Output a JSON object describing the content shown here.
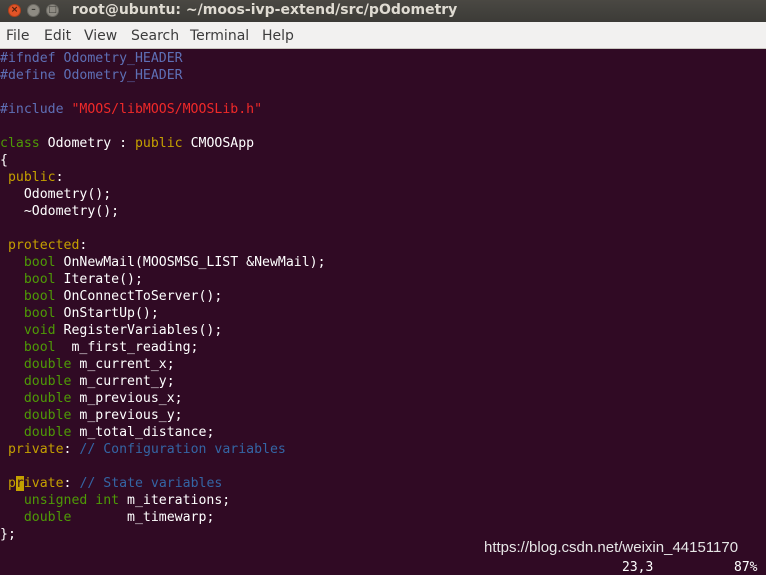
{
  "window": {
    "title": "root@ubuntu: ~/moos-ivp-extend/src/pOdometry",
    "close_glyph": "×",
    "minimize_glyph": "–",
    "maximize_glyph": "□"
  },
  "menu": [
    "File",
    "Edit",
    "View",
    "Search",
    "Terminal",
    "Help"
  ],
  "code": {
    "l1": "#ifndef Odometry_HEADER",
    "l2": "#define Odometry_HEADER",
    "l4": "#include ",
    "l4s": "\"MOOS/libMOOS/MOOSLib.h\"",
    "l6a": "class",
    "l6b": " Odometry : ",
    "l6c": "public",
    "l6d": " CMOOSApp",
    "l7": "{",
    "l8a": " public",
    "l8b": ":",
    "l9": "   Odometry();",
    "l10": "   ~Odometry();",
    "l12a": " protected",
    "l12b": ":",
    "l13a": "   bool",
    "l13b": " OnNewMail(MOOSMSG_LIST &NewMail);",
    "l14a": "   bool",
    "l14b": " Iterate();",
    "l15a": "   bool",
    "l15b": " OnConnectToServer();",
    "l16a": "   bool",
    "l16b": " OnStartUp();",
    "l17a": "   void",
    "l17b": " RegisterVariables();",
    "l18a": "   bool",
    "l18b": "  m_first_reading;",
    "l19a": "   double",
    "l19b": " m_current_x;",
    "l20a": "   double",
    "l20b": " m_current_y;",
    "l21a": "   double",
    "l21b": " m_previous_x;",
    "l22a": "   double",
    "l22b": " m_previous_y;",
    "l23a": "   double",
    "l23b": " m_total_distance;",
    "l24a": " private",
    "l24b": ": ",
    "l24c": "// Configuration variables",
    "l26pre": " p",
    "l26cur": "r",
    "l26a": "ivate",
    "l26b": ": ",
    "l26c": "// State variables",
    "l27a": "   unsigned int",
    "l27b": " m_iterations;",
    "l28a": "   double",
    "l28b": "       m_timewarp;",
    "l29": "};"
  },
  "watermark": "https://blog.csdn.net/weixin_44151170",
  "status": {
    "position": "23,3",
    "percent": "87%"
  },
  "colors": {
    "background": "#300a24",
    "keyword": "#c4a000",
    "type": "#4e9a06",
    "string": "#ef2929",
    "comment": "#3465a4",
    "preprocessor": "#5e6fb5"
  }
}
